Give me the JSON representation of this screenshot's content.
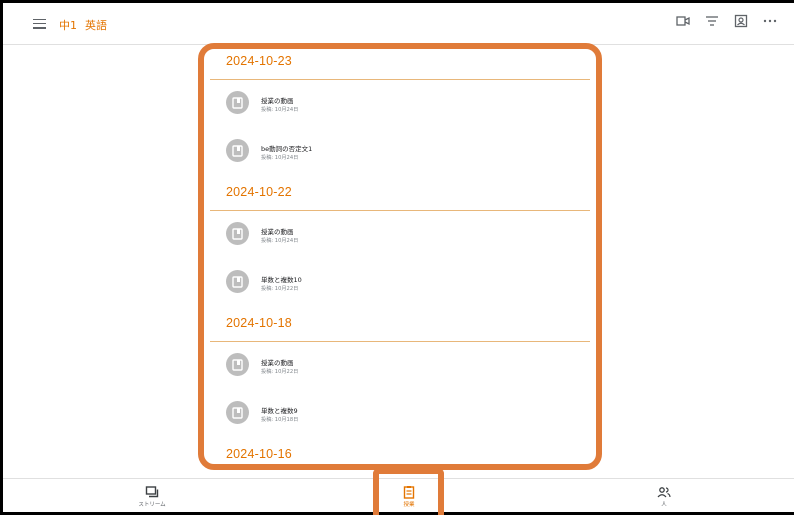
{
  "header": {
    "menu_icon": "menu-icon",
    "class_name": "中1",
    "subject": "英語",
    "actions": [
      "video-icon",
      "filter-icon",
      "contact-card-icon",
      "more-icon"
    ]
  },
  "sections": [
    {
      "date": "2024-10-23",
      "items": [
        {
          "title": "授業の動画",
          "posted": "投稿: 10月24日"
        },
        {
          "title": "be動詞の否定文1",
          "posted": "投稿: 10月24日"
        }
      ]
    },
    {
      "date": "2024-10-22",
      "items": [
        {
          "title": "授業の動画",
          "posted": "投稿: 10月24日"
        },
        {
          "title": "単数と複数10",
          "posted": "投稿: 10月22日"
        }
      ]
    },
    {
      "date": "2024-10-18",
      "items": [
        {
          "title": "授業の動画",
          "posted": "投稿: 10月22日"
        },
        {
          "title": "単数と複数9",
          "posted": "投稿: 10月18日"
        }
      ]
    },
    {
      "date": "2024-10-16",
      "items": []
    }
  ],
  "bottom_nav": [
    {
      "label": "ストリーム",
      "icon": "stream-icon"
    },
    {
      "label": "授業",
      "icon": "classwork-icon",
      "active": true
    },
    {
      "label": "人",
      "icon": "people-icon"
    }
  ],
  "colors": {
    "accent": "#e37400",
    "highlight": "#e07b39"
  }
}
